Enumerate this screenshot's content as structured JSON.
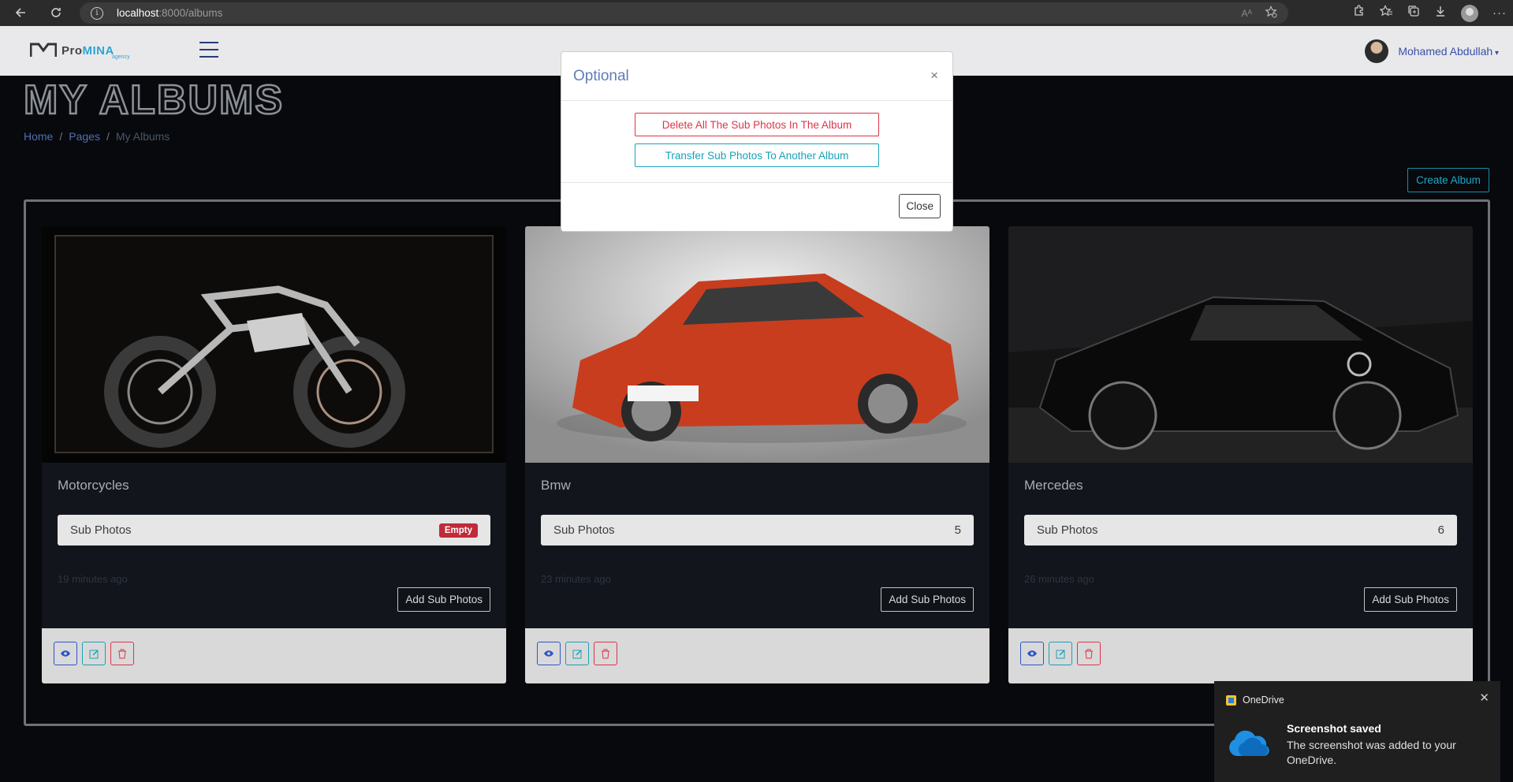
{
  "browser": {
    "url_host": "localhost",
    "url_path": ":8000/albums",
    "read_aloud_label": "Aᴬ",
    "icons": [
      "back-icon",
      "refresh-icon",
      "info-icon",
      "read-aloud-icon",
      "favorite-add-icon",
      "extensions-icon",
      "favorites-icon",
      "collections-icon",
      "downloads-icon",
      "profile-icon",
      "more-icon"
    ]
  },
  "navbar": {
    "brand_pre": "Pro",
    "brand_post": "MINA",
    "brand_sub": "agency",
    "user_name": "Mohamed Abdullah"
  },
  "header": {
    "title": "MY ALBUMS",
    "breadcrumb": [
      "Home",
      "Pages",
      "My Albums"
    ],
    "create_button": "Create Album"
  },
  "cards": [
    {
      "title": "Motorcycles",
      "sub_label": "Sub Photos",
      "badge": "Empty",
      "count": "",
      "ago": "19 minutes ago",
      "add_button": "Add Sub Photos"
    },
    {
      "title": "Bmw",
      "sub_label": "Sub Photos",
      "badge": "",
      "count": "5",
      "ago": "23 minutes ago",
      "add_button": "Add Sub Photos"
    },
    {
      "title": "Mercedes",
      "sub_label": "Sub Photos",
      "badge": "",
      "count": "6",
      "ago": "26 minutes ago",
      "add_button": "Add Sub Photos"
    }
  ],
  "modal": {
    "title": "Optional",
    "close_x": "×",
    "delete_button": "Delete All The Sub Photos In The Album",
    "transfer_button": "Transfer Sub Photos To Another Album",
    "close_button": "Close"
  },
  "toast": {
    "app": "OneDrive",
    "title": "Screenshot saved",
    "message": "The screenshot was added to your OneDrive.",
    "close": "✕"
  },
  "colors": {
    "danger": "#dc3545",
    "info": "#17a2b8",
    "primary": "#0d6efd"
  }
}
